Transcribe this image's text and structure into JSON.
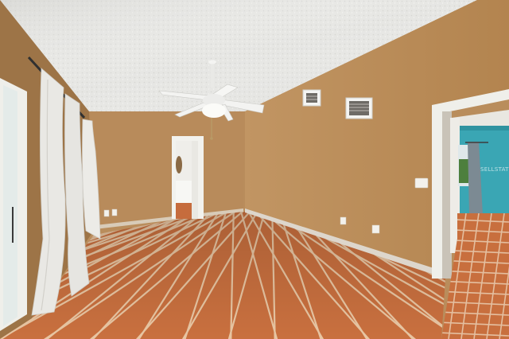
{
  "watermark": {
    "text": "SELLSTATE"
  },
  "colors": {
    "ceiling": "#e7e7e4",
    "wall_main": "#b98c5b",
    "wall_right": "#b88a5a",
    "wall_left": "#9f7649",
    "floor_tile": "#c9703f",
    "grout": "#e9c9a8",
    "baseboard": "#ddd6cc",
    "trim": "#eeeeea",
    "curtain": "#e9e8e4",
    "teal_wall": "#3aa6b4"
  }
}
